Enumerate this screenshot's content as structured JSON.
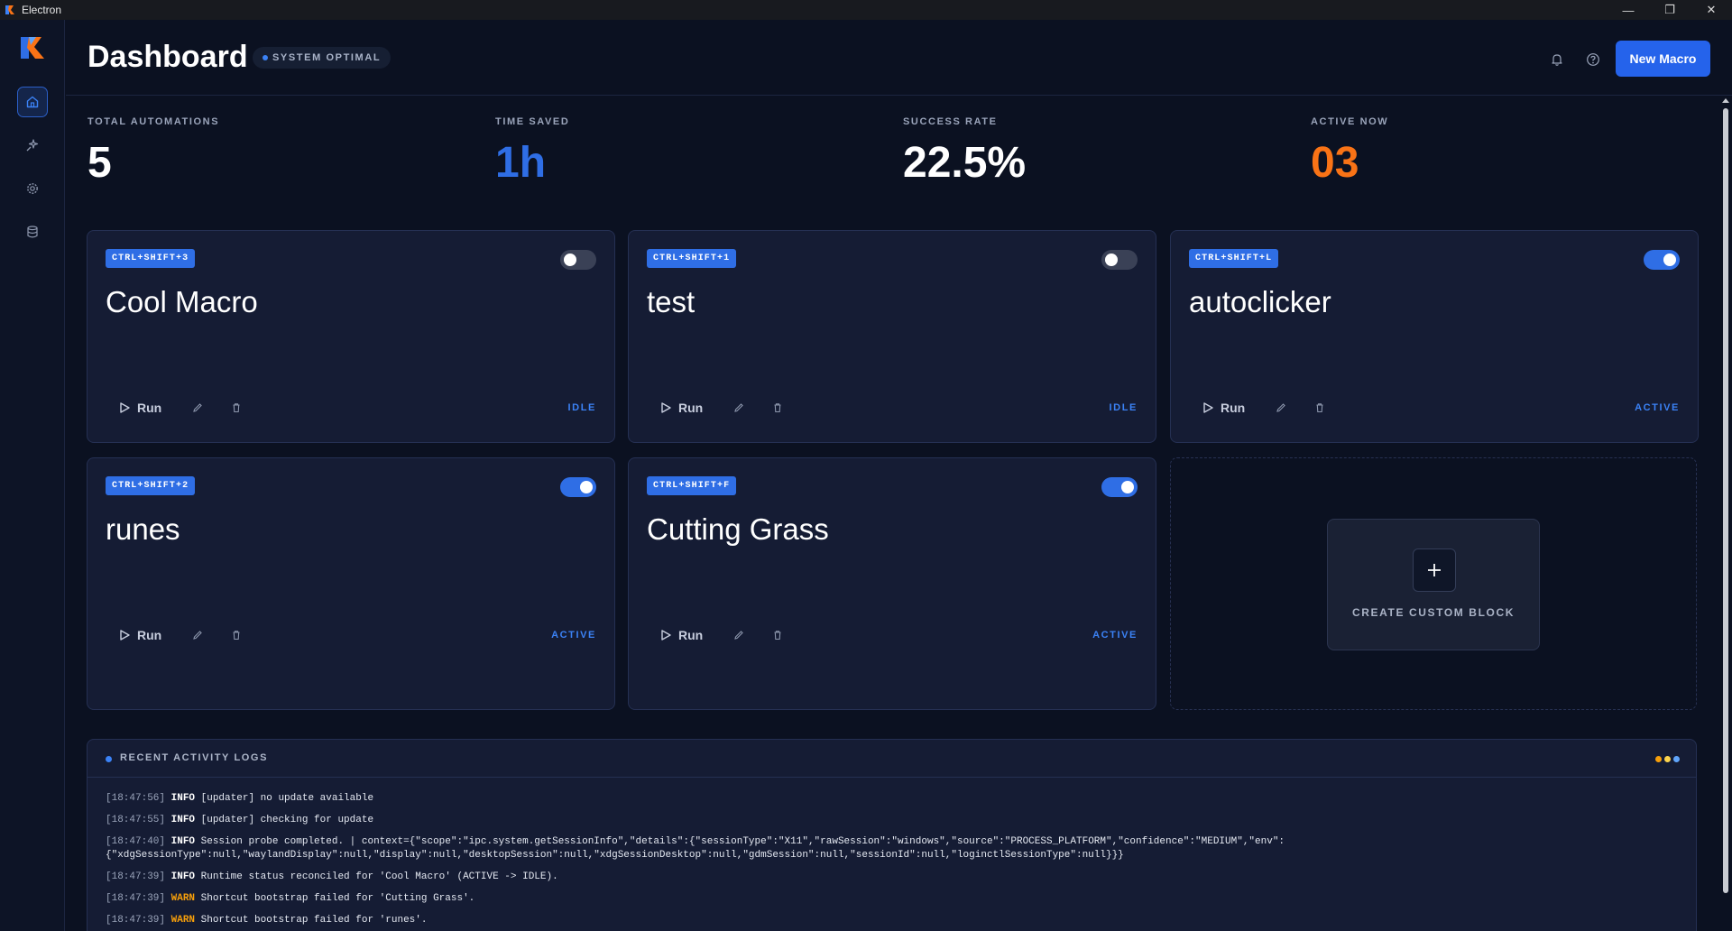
{
  "window": {
    "title": "Electron",
    "minimize": "—",
    "restore": "❐",
    "close": "✕"
  },
  "header": {
    "title": "Dashboard",
    "status": "SYSTEM OPTIMAL",
    "new_macro": "New Macro"
  },
  "stats": [
    {
      "label": "TOTAL AUTOMATIONS",
      "value": "5",
      "color": "#ffffff"
    },
    {
      "label": "TIME SAVED",
      "value": "1h",
      "color": "#2f6ee5"
    },
    {
      "label": "SUCCESS RATE",
      "value": "22.5%",
      "color": "#ffffff"
    },
    {
      "label": "ACTIVE NOW",
      "value": "03",
      "color": "#f97316"
    }
  ],
  "macros": [
    {
      "hotkey": "CTRL+SHIFT+3",
      "name": "Cool Macro",
      "enabled": false,
      "run": "Run",
      "state": "IDLE"
    },
    {
      "hotkey": "CTRL+SHIFT+1",
      "name": "test",
      "enabled": false,
      "run": "Run",
      "state": "IDLE"
    },
    {
      "hotkey": "CTRL+SHIFT+L",
      "name": "autoclicker",
      "enabled": true,
      "run": "Run",
      "state": "ACTIVE"
    },
    {
      "hotkey": "CTRL+SHIFT+2",
      "name": "runes",
      "enabled": true,
      "run": "Run",
      "state": "ACTIVE"
    },
    {
      "hotkey": "CTRL+SHIFT+F",
      "name": "Cutting Grass",
      "enabled": true,
      "run": "Run",
      "state": "ACTIVE"
    }
  ],
  "create_block": {
    "label": "CREATE CUSTOM BLOCK",
    "plus": "+"
  },
  "logs": {
    "title": "RECENT ACTIVITY LOGS",
    "dot_colors": [
      "#f59e0b",
      "#fcd34d",
      "#60a5fa"
    ],
    "lines": [
      {
        "ts": "[18:47:56]",
        "level": "INFO",
        "msg": " [updater] no update available"
      },
      {
        "ts": "[18:47:55]",
        "level": "INFO",
        "msg": " [updater] checking for update"
      },
      {
        "ts": "[18:47:40]",
        "level": "INFO",
        "msg": " Session probe completed. | context={\"scope\":\"ipc.system.getSessionInfo\",\"details\":{\"sessionType\":\"X11\",\"rawSession\":\"windows\",\"source\":\"PROCESS_PLATFORM\",\"confidence\":\"MEDIUM\",\"env\":",
        "msg2": "{\"xdgSessionType\":null,\"waylandDisplay\":null,\"display\":null,\"desktopSession\":null,\"xdgSessionDesktop\":null,\"gdmSession\":null,\"sessionId\":null,\"loginctlSessionType\":null}}}"
      },
      {
        "ts": "[18:47:39]",
        "level": "INFO",
        "msg": " Runtime status reconciled for 'Cool Macro' (ACTIVE -> IDLE)."
      },
      {
        "ts": "[18:47:39]",
        "level": "WARN",
        "msg": " Shortcut bootstrap failed for 'Cutting Grass'."
      },
      {
        "ts": "[18:47:39]",
        "level": "WARN",
        "msg": " Shortcut bootstrap failed for 'runes'."
      }
    ]
  },
  "colors": {
    "accent": "#2563eb",
    "background": "#0b1121",
    "card": "#151c34",
    "warn": "#f59e0b",
    "active_orange": "#f97316"
  }
}
